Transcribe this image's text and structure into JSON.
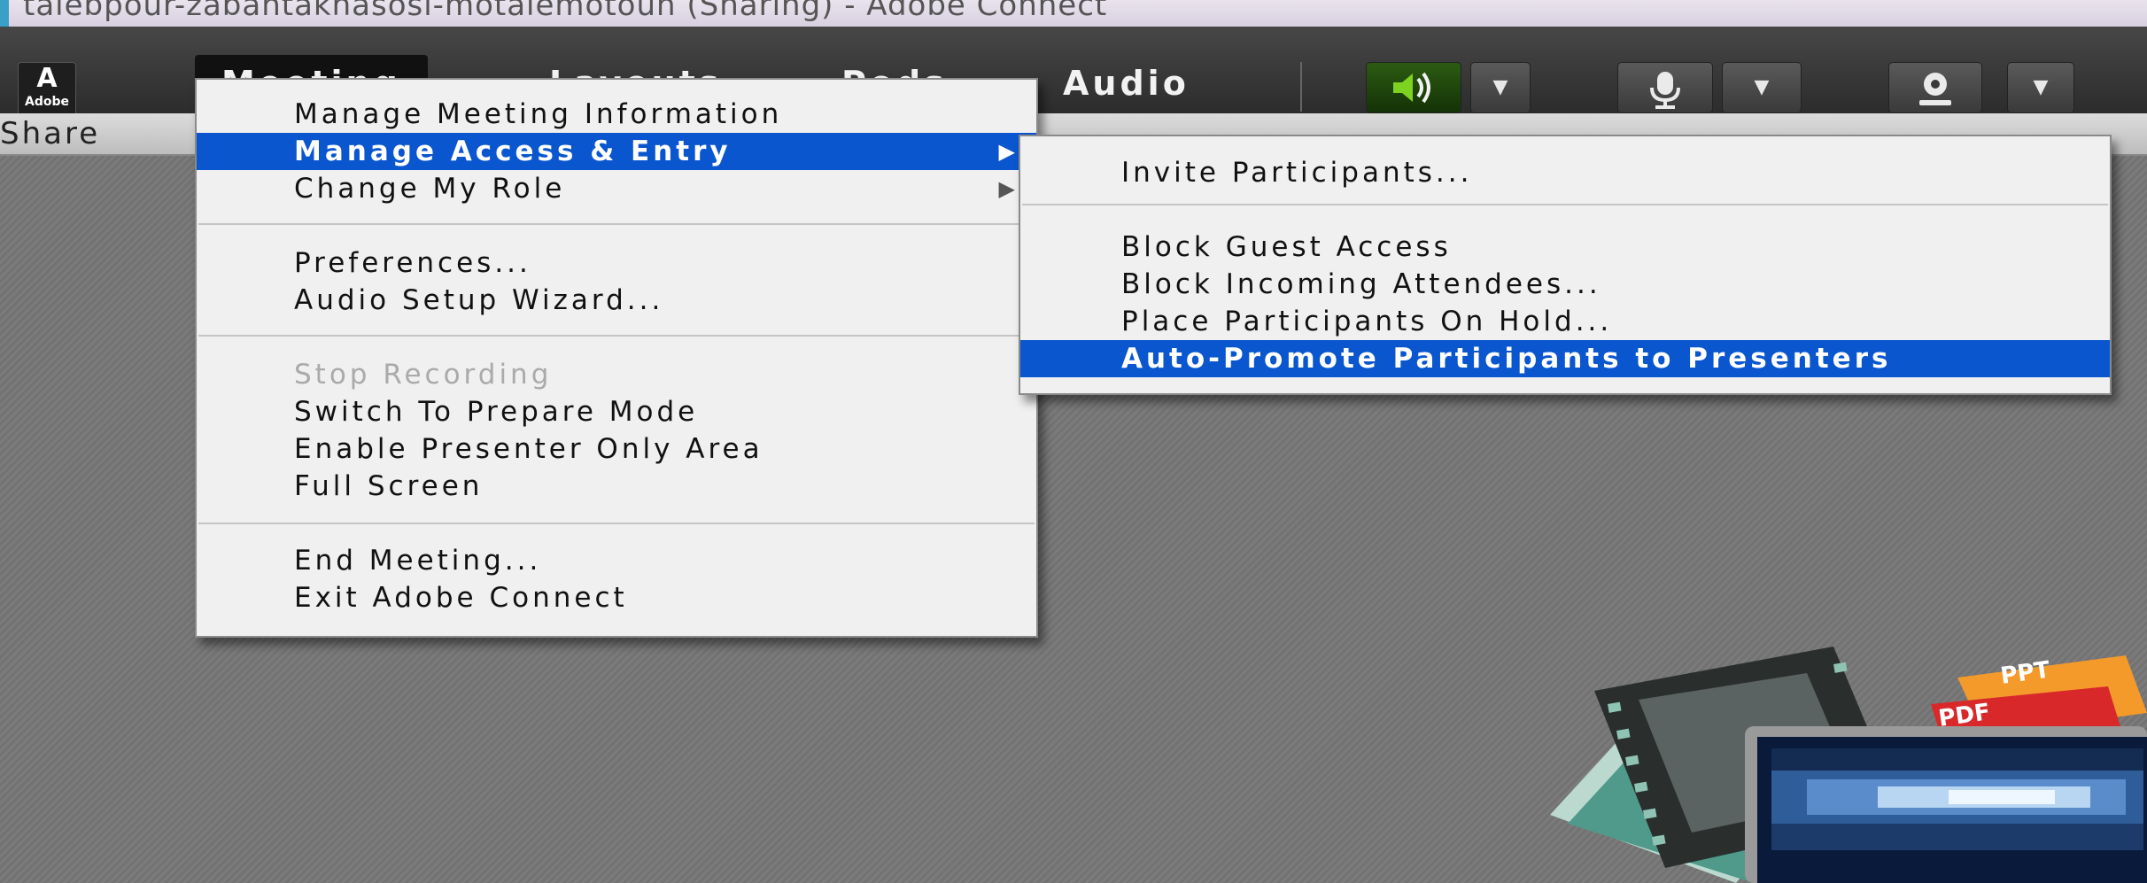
{
  "window": {
    "title": "talebpour-zabantakhasosi-motalemotoun (Sharing) - Adobe Connect"
  },
  "logo": {
    "mark": "A",
    "label": "Adobe"
  },
  "menubar": {
    "items": [
      {
        "label": "Meeting"
      },
      {
        "label": "Layouts"
      },
      {
        "label": "Pods"
      },
      {
        "label": "Audio"
      }
    ]
  },
  "toolbar": {
    "speaker_icon": "speaker-icon",
    "microphone_icon": "microphone-icon",
    "camera_icon": "webcam-icon",
    "dropdown_glyph": "▼",
    "speaker_glyph": "🔊",
    "mic_glyph": "🎤",
    "cam_glyph": "◉",
    "accent": "#2c5b12"
  },
  "sharebar": {
    "label": "Share"
  },
  "meeting_menu": {
    "items": [
      {
        "label": "Manage Meeting Information"
      },
      {
        "label": "Manage Access & Entry",
        "arrow": "▶"
      },
      {
        "label": "Change My Role",
        "arrow": "▶"
      },
      {
        "label": "Preferences..."
      },
      {
        "label": "Audio Setup Wizard..."
      },
      {
        "label": "Stop Recording"
      },
      {
        "label": "Switch To Prepare Mode"
      },
      {
        "label": "Enable Presenter Only Area"
      },
      {
        "label": "Full Screen"
      },
      {
        "label": "End Meeting..."
      },
      {
        "label": "Exit Adobe Connect"
      }
    ]
  },
  "access_submenu": {
    "items": [
      {
        "label": "Invite Participants..."
      },
      {
        "label": "Block Guest Access"
      },
      {
        "label": "Block Incoming Attendees..."
      },
      {
        "label": "Place Participants On Hold..."
      },
      {
        "label": "Auto-Promote Participants to Presenters"
      }
    ]
  },
  "illustration": {
    "tab1": "PPT",
    "tab2": "PDF"
  },
  "colors": {
    "highlight": "#0a56cf",
    "menu_bg": "#f0f0f0",
    "menubar": "#3a3a3a"
  }
}
